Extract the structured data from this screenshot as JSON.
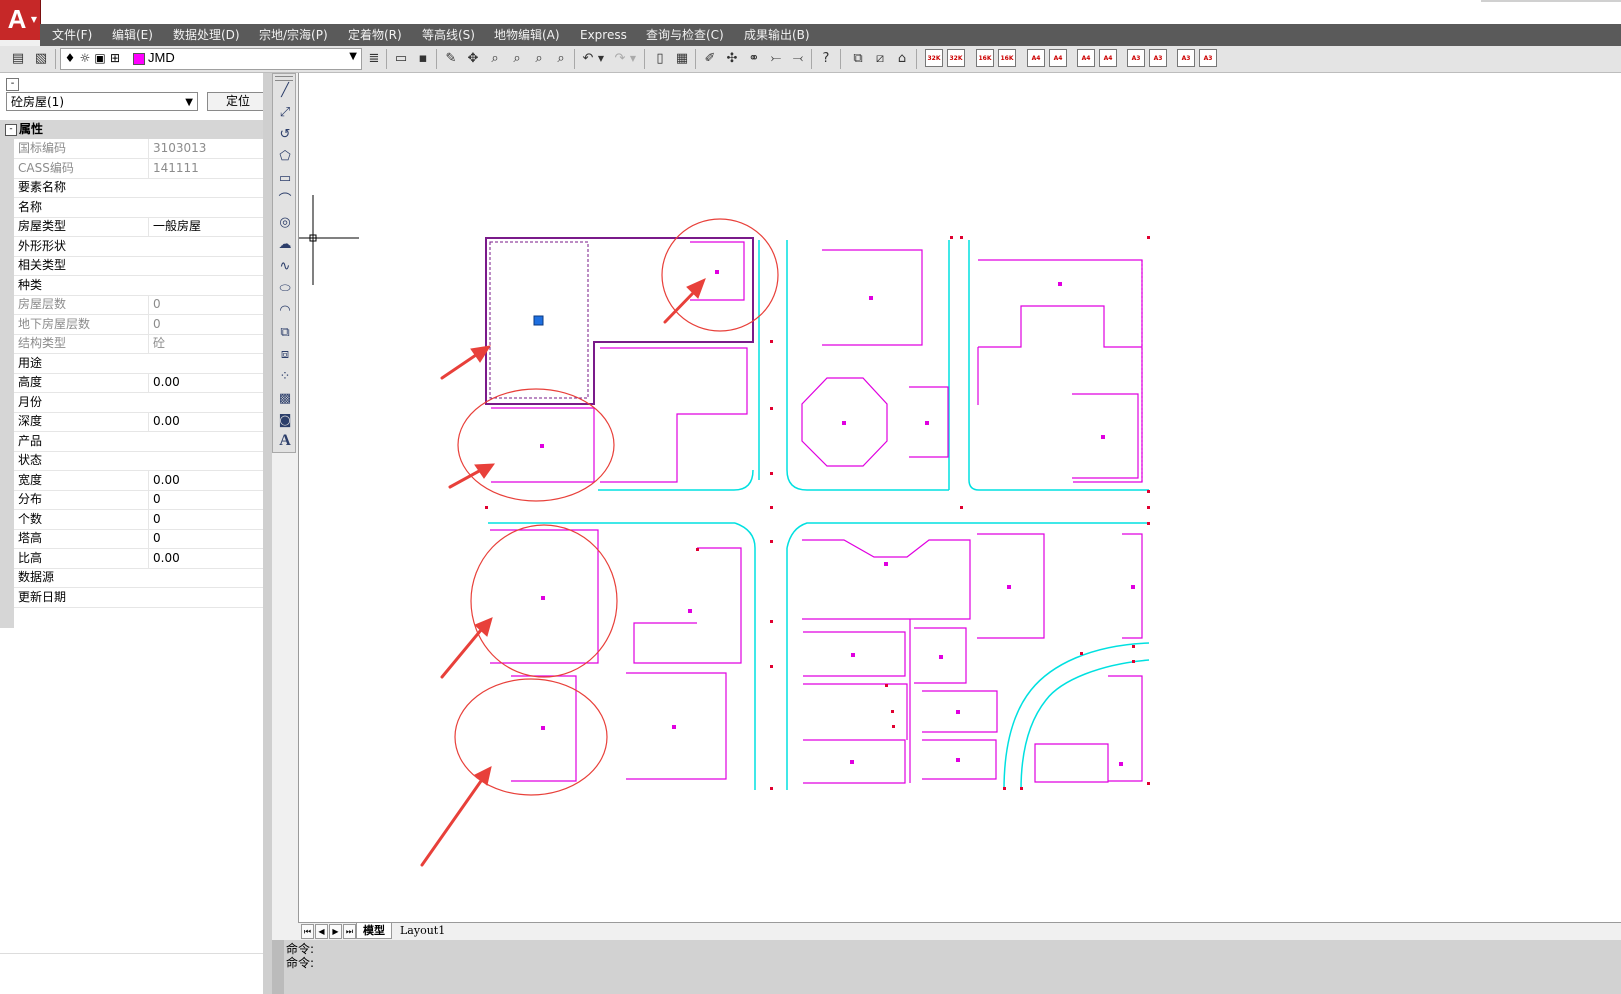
{
  "menu": [
    "文件(F)",
    "编辑(E)",
    "数据处理(D)",
    "宗地/宗海(P)",
    "定着物(R)",
    "等高线(S)",
    "地物编辑(A)",
    "Express",
    "查询与检查(C)",
    "成果输出(B)"
  ],
  "toolbar": {
    "layer_name": "JMD",
    "layer_color": "#ff00ff",
    "scale_buttons": [
      "32K",
      "32K",
      "16K",
      "16K",
      "A4",
      "A4",
      "A4",
      "A4",
      "A3",
      "A3",
      "A3",
      "A3"
    ]
  },
  "panel": {
    "entity_select": "砼房屋(1)",
    "locate_button": "定位",
    "section_title": "属性",
    "rows": [
      {
        "k": "国标编码",
        "v": "3103013",
        "ro": true
      },
      {
        "k": "CASS编码",
        "v": "141111",
        "ro": true
      },
      {
        "k": "要素名称",
        "v": "",
        "ro": false
      },
      {
        "k": "名称",
        "v": "",
        "ro": false
      },
      {
        "k": "房屋类型",
        "v": "一般房屋",
        "ro": false
      },
      {
        "k": "外形形状",
        "v": "",
        "ro": false
      },
      {
        "k": "相关类型",
        "v": "",
        "ro": false
      },
      {
        "k": "种类",
        "v": "",
        "ro": false
      },
      {
        "k": "房屋层数",
        "v": "0",
        "ro": true
      },
      {
        "k": "地下房屋层数",
        "v": "0",
        "ro": true
      },
      {
        "k": "结构类型",
        "v": "砼",
        "ro": true
      },
      {
        "k": "用途",
        "v": "",
        "ro": false
      },
      {
        "k": "高度",
        "v": "0.00",
        "ro": false
      },
      {
        "k": "月份",
        "v": "",
        "ro": false
      },
      {
        "k": "深度",
        "v": "0.00",
        "ro": false
      },
      {
        "k": "产品",
        "v": "",
        "ro": false
      },
      {
        "k": "状态",
        "v": "",
        "ro": false
      },
      {
        "k": "宽度",
        "v": "0.00",
        "ro": false
      },
      {
        "k": "分布",
        "v": "0",
        "ro": false
      },
      {
        "k": "个数",
        "v": "0",
        "ro": false
      },
      {
        "k": "塔高",
        "v": "0",
        "ro": false
      },
      {
        "k": "比高",
        "v": "0.00",
        "ro": false
      },
      {
        "k": "数据源",
        "v": "",
        "ro": false
      },
      {
        "k": "更新日期",
        "v": "",
        "ro": false
      }
    ]
  },
  "tabs": {
    "model": "模型",
    "layout1": "Layout1"
  },
  "command": {
    "line1": "命令:",
    "line2": "命令:"
  },
  "colors": {
    "building": "#e000e0",
    "road": "#00e0e0",
    "annotation": "#e8403a",
    "vertex": "#e00030"
  }
}
